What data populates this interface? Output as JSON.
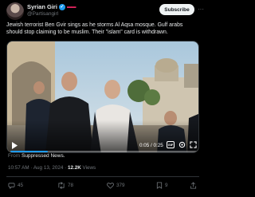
{
  "author": {
    "name": "Syrian Giri",
    "flag": "▬▬",
    "handle": "@Partisangirl"
  },
  "buttons": {
    "subscribe": "Subscribe",
    "more": "···"
  },
  "tweet": {
    "text": "Jewish terrorist Ben Gvir sings as he storms Al Aqsa mosque. Gulf arabs should stop claiming to be muslim. Their \"islam\" card is withdrawn."
  },
  "video": {
    "time": "0:05 / 0:25",
    "progress": 0.2,
    "icons": [
      "play-icon",
      "gif-icon",
      "settings-icon",
      "fullscreen-icon"
    ]
  },
  "source": {
    "prefix": "From",
    "name": "Suppressed News."
  },
  "meta": {
    "time": "10:57 AM",
    "date": "Aug 13, 2024",
    "views": "12.2K",
    "views_label": "Views"
  },
  "actions": {
    "replies": "45",
    "reposts": "78",
    "likes": "379",
    "bookmarks": "9"
  },
  "colors": {
    "accent": "#1d9bf0",
    "background": "#000000",
    "muted": "#71767b"
  }
}
